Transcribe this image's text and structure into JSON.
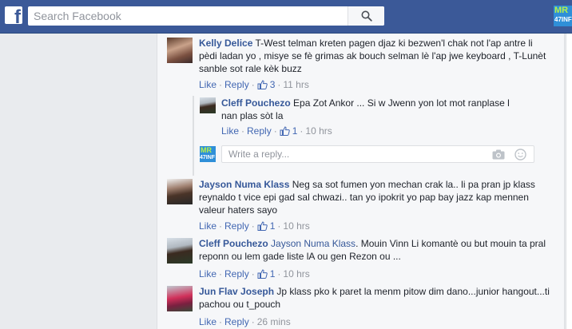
{
  "search": {
    "placeholder": "Search Facebook"
  },
  "profile_badge": {
    "top": "MR",
    "bottom": "47INF"
  },
  "reply_box": {
    "placeholder": "Write a reply..."
  },
  "actions": {
    "like": "Like",
    "reply": "Reply",
    "sep": "·"
  },
  "comments": [
    {
      "author": "Kelly Delice",
      "text": "T-West telman kreten pagen djaz ki bezwen'l chak not l'ap antre li pèdi ladan yo , misye se fè grimas ak bouch selman lè l'ap jwe keyboard , T-Lunèt sanble sot rale kèk buzz",
      "like_count": "3",
      "time": "11 hrs"
    },
    {
      "author": "Cleff Pouchezo",
      "text": "Epa Zot Ankor ... Si w Jwenn yon lot mot ranplase l nan plas sòt la",
      "like_count": "1",
      "time": "10 hrs"
    },
    {
      "author": "Jayson Numa Klass",
      "text": "Neg sa sot fumen yon mechan crak la.. li pa pran jp klass reynaldo t vice epi gad sal chwazi.. tan yo ipokrit yo pap bay jazz kap mennen valeur haters sayo",
      "like_count": "1",
      "time": "10 hrs"
    },
    {
      "author": "Cleff Pouchezo",
      "mention": "Jayson Numa Klass",
      "text": ". Mouin Vinn Li komantè ou but mouin ta pral reponn ou lem gade liste lA ou gen Rezon ou ...",
      "like_count": "1",
      "time": "10 hrs"
    },
    {
      "author": "Jun Flav Joseph",
      "text": "Jp klass pko k paret la menm pitow dim dano...junior hangout...ti pachou ou t_pouch",
      "time": "26 mins"
    }
  ]
}
